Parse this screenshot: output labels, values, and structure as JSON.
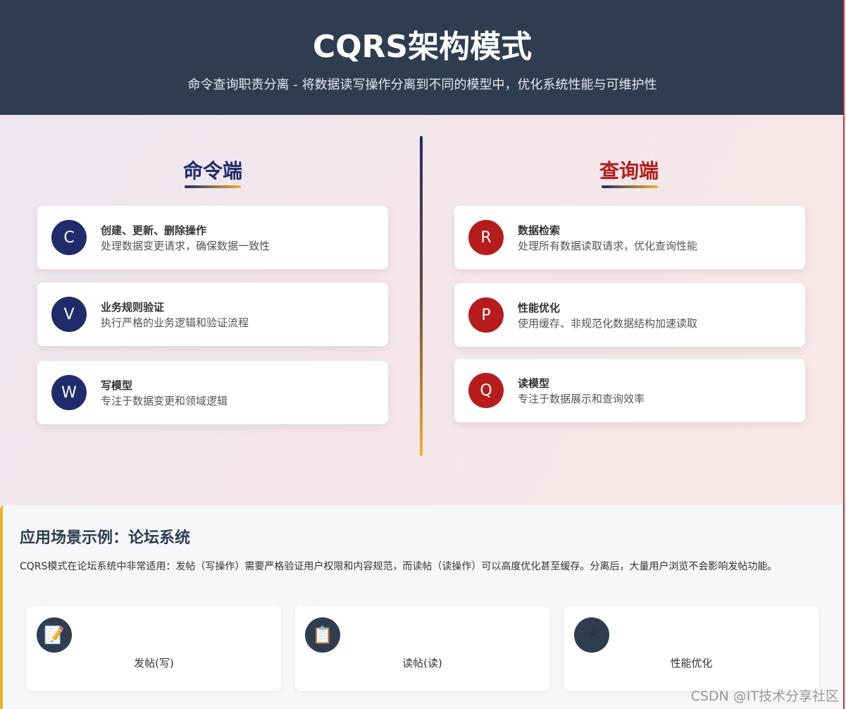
{
  "header": {
    "title": "CQRS架构模式",
    "subtitle": "命令查询职责分离 - 将数据读写操作分离到不同的模型中，优化系统性能与可维护性"
  },
  "command": {
    "title": "命令端",
    "cards": [
      {
        "badge": "C",
        "title": "创建、更新、删除操作",
        "desc": "处理数据变更请求，确保数据一致性"
      },
      {
        "badge": "V",
        "title": "业务规则验证",
        "desc": "执行严格的业务逻辑和验证流程"
      },
      {
        "badge": "W",
        "title": "写模型",
        "desc": "专注于数据变更和领域逻辑"
      }
    ]
  },
  "query": {
    "title": "查询端",
    "cards": [
      {
        "badge": "R",
        "title": "数据检索",
        "desc": "处理所有数据读取请求，优化查询性能"
      },
      {
        "badge": "P",
        "title": "性能优化",
        "desc": "使用缓存、非规范化数据结构加速读取"
      },
      {
        "badge": "Q",
        "title": "读模型",
        "desc": "专注于数据展示和查询效率"
      }
    ]
  },
  "scenario": {
    "title": "应用场景示例：论坛系统",
    "text": "CQRS模式在论坛系统中非常适用：发帖（写操作）需要严格验证用户权限和内容规范，而读帖（读操作）可以高度优化甚至缓存。分离后，大量用户浏览不会影响发帖功能。",
    "cards": [
      {
        "icon": "📝",
        "label": "发帖(写)",
        "icon_name": "memo-icon"
      },
      {
        "icon": "📋",
        "label": "读帖(读)",
        "icon_name": "clipboard-icon"
      },
      {
        "icon": "⚡",
        "label": "性能优化",
        "icon_name": "lightning-icon"
      }
    ]
  },
  "watermark": "CSDN @IT技术分享社区",
  "colors": {
    "header_bg": "#2e3d50",
    "command_accent": "#1f2b6b",
    "query_accent": "#b71c1c",
    "highlight": "#f0b22a"
  }
}
